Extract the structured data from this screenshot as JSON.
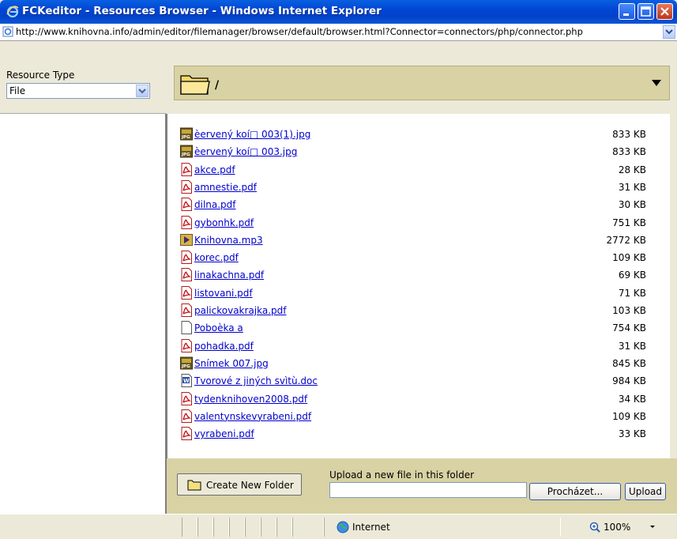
{
  "window": {
    "title": "FCKeditor - Resources Browser - Windows Internet Explorer",
    "url": "http://www.knihovna.info/admin/editor/filemanager/browser/default/browser.html?Connector=connectors/php/connector.php"
  },
  "resource_type": {
    "label": "Resource Type",
    "selected": "File"
  },
  "current_folder": "/",
  "files": [
    {
      "name": "èervený koí□ 003(1).jpg",
      "size": "833 KB",
      "icon": "jpg-icon"
    },
    {
      "name": "èervený koí□ 003.jpg",
      "size": "833 KB",
      "icon": "jpg-icon"
    },
    {
      "name": "akce.pdf",
      "size": "28 KB",
      "icon": "pdf-icon"
    },
    {
      "name": "amnestie.pdf",
      "size": "31 KB",
      "icon": "pdf-icon"
    },
    {
      "name": "dilna.pdf",
      "size": "30 KB",
      "icon": "pdf-icon"
    },
    {
      "name": "gybonhk.pdf",
      "size": "751 KB",
      "icon": "pdf-icon"
    },
    {
      "name": "Knihovna.mp3",
      "size": "2772 KB",
      "icon": "mp3-icon"
    },
    {
      "name": "korec.pdf",
      "size": "109 KB",
      "icon": "pdf-icon"
    },
    {
      "name": "linakachna.pdf",
      "size": "69 KB",
      "icon": "pdf-icon"
    },
    {
      "name": "listovani.pdf",
      "size": "71 KB",
      "icon": "pdf-icon"
    },
    {
      "name": "palickovakrajka.pdf",
      "size": "103 KB",
      "icon": "pdf-icon"
    },
    {
      "name": "Poboèka a",
      "size": "754 KB",
      "icon": "file-icon"
    },
    {
      "name": "pohadka.pdf",
      "size": "31 KB",
      "icon": "pdf-icon"
    },
    {
      "name": "Snímek 007.jpg",
      "size": "845 KB",
      "icon": "jpg-icon"
    },
    {
      "name": "Tvorové z jiných svìtù.doc",
      "size": "984 KB",
      "icon": "doc-icon"
    },
    {
      "name": "tydenknihoven2008.pdf",
      "size": "34 KB",
      "icon": "pdf-icon"
    },
    {
      "name": "valentynskevyrabeni.pdf",
      "size": "109 KB",
      "icon": "pdf-icon"
    },
    {
      "name": "vyrabeni.pdf",
      "size": "33 KB",
      "icon": "pdf-icon"
    }
  ],
  "footer": {
    "create_folder_label": "Create New Folder",
    "upload_label": "Upload a new file in this folder",
    "browse_label": "Procházet...",
    "upload_button": "Upload"
  },
  "status": {
    "zone": "Internet",
    "zoom": "100%"
  }
}
